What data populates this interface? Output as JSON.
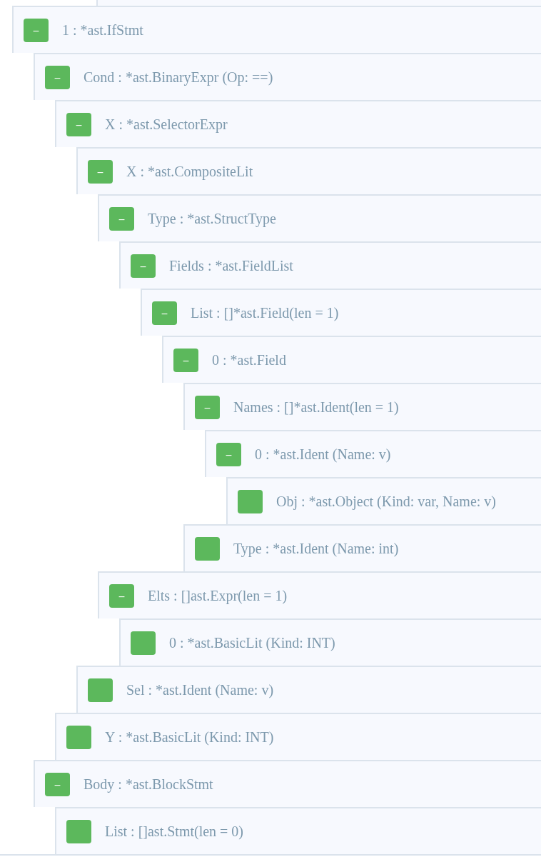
{
  "tree": [
    {
      "label": "1 : *ast.IfStmt",
      "kind": "branch",
      "toggle": "–",
      "children": [
        {
          "label": "Cond : *ast.BinaryExpr (Op: ==)",
          "kind": "branch",
          "toggle": "–",
          "children": [
            {
              "label": "X : *ast.SelectorExpr",
              "kind": "branch",
              "toggle": "–",
              "children": [
                {
                  "label": "X : *ast.CompositeLit",
                  "kind": "branch",
                  "toggle": "–",
                  "children": [
                    {
                      "label": "Type : *ast.StructType",
                      "kind": "branch",
                      "toggle": "–",
                      "children": [
                        {
                          "label": "Fields : *ast.FieldList",
                          "kind": "branch",
                          "toggle": "–",
                          "children": [
                            {
                              "label": "List : []*ast.Field(len = 1)",
                              "kind": "branch",
                              "toggle": "–",
                              "children": [
                                {
                                  "label": "0 : *ast.Field",
                                  "kind": "branch",
                                  "toggle": "–",
                                  "children": [
                                    {
                                      "label": "Names : []*ast.Ident(len = 1)",
                                      "kind": "branch",
                                      "toggle": "–",
                                      "children": [
                                        {
                                          "label": "0 : *ast.Ident (Name: v)",
                                          "kind": "branch",
                                          "toggle": "–",
                                          "children": [
                                            {
                                              "label": "Obj : *ast.Object (Kind: var, Name: v)",
                                              "kind": "leaf"
                                            }
                                          ]
                                        }
                                      ]
                                    },
                                    {
                                      "label": "Type : *ast.Ident (Name: int)",
                                      "kind": "leaf"
                                    }
                                  ]
                                }
                              ]
                            }
                          ]
                        }
                      ]
                    },
                    {
                      "label": "Elts : []ast.Expr(len = 1)",
                      "kind": "branch",
                      "toggle": "–",
                      "children": [
                        {
                          "label": "0 : *ast.BasicLit (Kind: INT)",
                          "kind": "leaf"
                        }
                      ]
                    }
                  ]
                },
                {
                  "label": "Sel : *ast.Ident (Name: v)",
                  "kind": "leaf"
                }
              ]
            },
            {
              "label": "Y : *ast.BasicLit (Kind: INT)",
              "kind": "leaf"
            }
          ]
        },
        {
          "label": "Body : *ast.BlockStmt",
          "kind": "branch",
          "toggle": "–",
          "children": [
            {
              "label": "List : []ast.Stmt(len = 0)",
              "kind": "leaf"
            }
          ]
        }
      ]
    }
  ]
}
